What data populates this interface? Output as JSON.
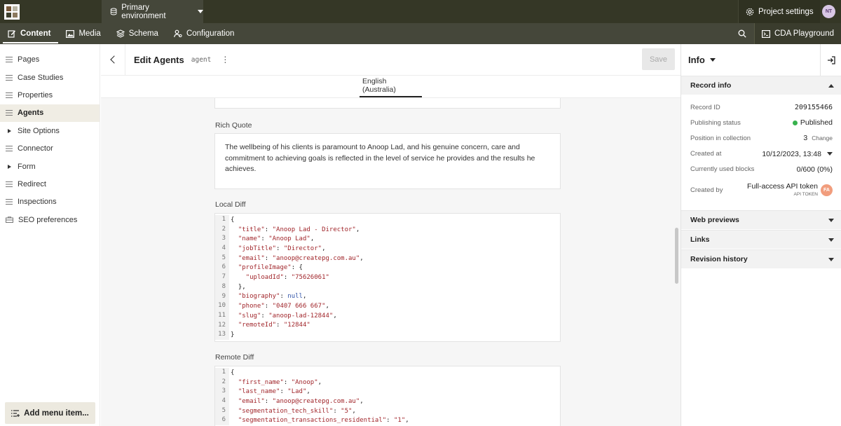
{
  "topbar": {
    "environment": "Primary environment",
    "project_settings": "Project settings",
    "avatar_initials": "NT"
  },
  "nav": {
    "tabs": [
      {
        "label": "Content",
        "active": true
      },
      {
        "label": "Media"
      },
      {
        "label": "Schema"
      },
      {
        "label": "Configuration"
      }
    ],
    "playground": "CDA Playground"
  },
  "sidebar": {
    "items": [
      {
        "label": "Pages",
        "icon": "list-icon"
      },
      {
        "label": "Case Studies",
        "icon": "list-icon"
      },
      {
        "label": "Properties",
        "icon": "list-icon"
      },
      {
        "label": "Agents",
        "icon": "list-icon",
        "active": true
      },
      {
        "label": "Site Options",
        "icon": "caret-right-icon"
      },
      {
        "label": "Connector",
        "icon": "list-icon"
      },
      {
        "label": "Form",
        "icon": "caret-right-icon"
      },
      {
        "label": "Redirect",
        "icon": "list-icon"
      },
      {
        "label": "Inspections",
        "icon": "list-icon"
      },
      {
        "label": "SEO preferences",
        "icon": "briefcase-icon"
      }
    ],
    "add_menu": "Add menu item..."
  },
  "editor": {
    "title": "Edit Agents",
    "model": "agent",
    "save": "Save",
    "locale_tab": "English (Australia)",
    "rich_quote_label": "Rich Quote",
    "rich_quote_text": "The wellbeing of his clients is paramount to Anoop Lad, and his genuine concern, care and commitment to achieving goals is reflected in the level of service he provides and the results he achieves.",
    "local_diff_label": "Local Diff",
    "local_diff_lines": [
      "{",
      "  \"title\": \"Anoop Lad - Director\",",
      "  \"name\": \"Anoop Lad\",",
      "  \"jobTitle\": \"Director\",",
      "  \"email\": \"anoop@createpg.com.au\",",
      "  \"profileImage\": {",
      "    \"uploadId\": \"75626061\"",
      "  },",
      "  \"biography\": null,",
      "  \"phone\": \"0407 666 667\",",
      "  \"slug\": \"anoop-lad-12844\",",
      "  \"remoteId\": \"12844\"",
      "}"
    ],
    "remote_diff_label": "Remote Diff",
    "remote_diff_lines": [
      "{",
      "  \"first_name\": \"Anoop\",",
      "  \"last_name\": \"Lad\",",
      "  \"email\": \"anoop@createpg.com.au\",",
      "  \"segmentation_tech_skill\": \"5\",",
      "  \"segmentation_transactions_residential\": \"1\","
    ]
  },
  "info_panel": {
    "title": "Info",
    "record_info": "Record info",
    "rows": {
      "record_id_label": "Record ID",
      "record_id": "209155466",
      "status_label": "Publishing status",
      "status": "Published",
      "position_label": "Position in collection",
      "position": "3",
      "change": "Change",
      "created_at_label": "Created at",
      "created_at": "10/12/2023, 13:48",
      "blocks_label": "Currently used blocks",
      "blocks": "0/600 (0%)",
      "created_by_label": "Created by",
      "created_by": "Full-access API token",
      "created_by_sub": "API TOKEN",
      "created_by_initials": "FA"
    },
    "sections": [
      "Web previews",
      "Links",
      "Revision history"
    ]
  },
  "colors": {
    "topbar": "#353726",
    "nav": "#45473a",
    "published": "#37b24d"
  }
}
